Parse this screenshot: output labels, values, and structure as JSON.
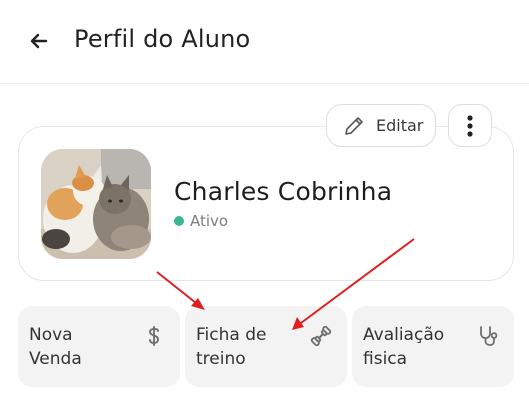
{
  "header": {
    "title": "Perfil do Aluno",
    "back_icon": "arrow-left-icon"
  },
  "profile": {
    "name": "Charles Cobrinha",
    "status": "Ativo",
    "status_color": "#3cb88a",
    "edit_label": "Editar",
    "edit_icon": "pencil-icon",
    "more_icon": "more-vertical-icon"
  },
  "actions": [
    {
      "label": "Nova\nVenda",
      "icon": "dollar-icon"
    },
    {
      "label": "Ficha de\ntreino",
      "icon": "dumbbell-icon"
    },
    {
      "label": "Avaliação\nfisica",
      "icon": "stethoscope-icon"
    }
  ],
  "annotations": {
    "arrow_color": "#e02020"
  }
}
